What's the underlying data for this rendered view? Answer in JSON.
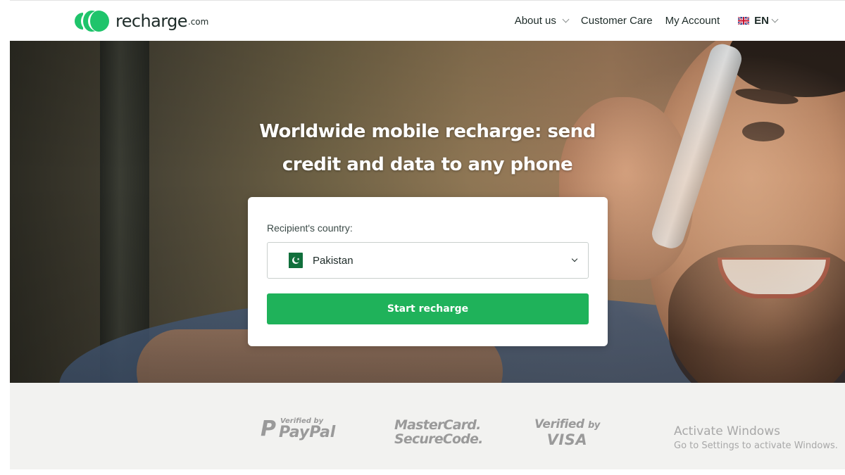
{
  "brand": {
    "name": "recharge",
    "tld": ".com",
    "accent_color": "#1fc46b",
    "button_color": "#1fb25a"
  },
  "nav": {
    "about": "About us",
    "care": "Customer Care",
    "account": "My Account",
    "language": "EN"
  },
  "hero": {
    "title_line1": "Worldwide mobile recharge: send",
    "title_line2": "credit and data to any phone"
  },
  "form": {
    "country_label": "Recipient's country:",
    "country_value": "Pakistan",
    "country_flag_icon": "pakistan-flag-icon",
    "submit_label": "Start recharge"
  },
  "trust_badges": {
    "paypal_small": "Verified by",
    "paypal_big": "PayPal",
    "mastercard_line1": "MasterCard.",
    "mastercard_line2": "SecureCode.",
    "visa_verified": "Verified",
    "visa_by": "by",
    "visa_big": "VISA"
  },
  "watermark": {
    "title": "Activate Windows",
    "subtitle": "Go to Settings to activate Windows."
  }
}
